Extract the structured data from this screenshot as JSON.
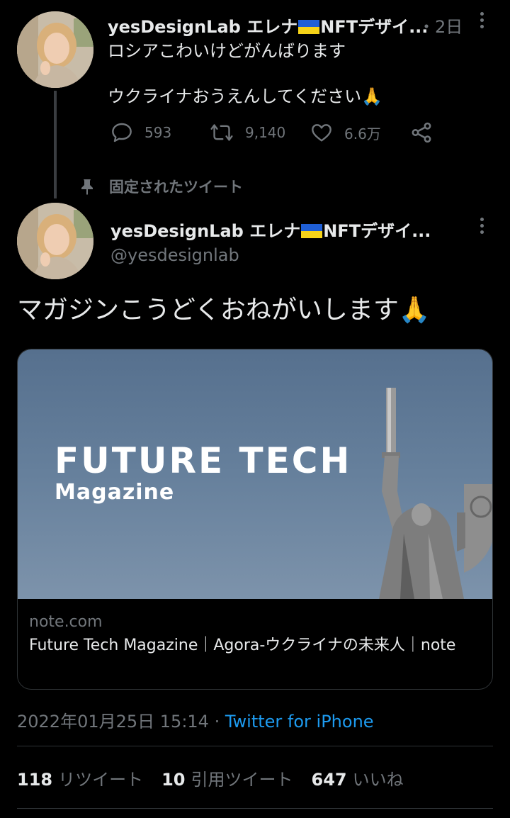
{
  "first_tweet": {
    "name": "yesDesignLab エレナ",
    "name_suffix": "NFTデザイ...",
    "time": "・2日",
    "line1": "ロシアこわいけどがんばります",
    "line2": "ウクライナおうえんしてください🙏",
    "replies": "593",
    "retweets": "9,140",
    "likes": "6.6万"
  },
  "pinned_label": "固定されたツイート",
  "main_tweet": {
    "name": "yesDesignLab エレナ",
    "name_suffix": "NFTデザイ...",
    "handle": "@yesdesignlab",
    "text": "マガジンこうどくおねがいします🙏",
    "card": {
      "image_title": "FUTURE TECH",
      "image_subtitle": "Magazine",
      "domain": "note.com",
      "title": "Future Tech Magazine｜Agora-ウクライナの未来人｜note"
    },
    "timestamp": "2022年01月25日 15:14 · ",
    "source": "Twitter for iPhone",
    "stats": {
      "retweets_count": "118",
      "retweets_label": "リツイート",
      "quotes_count": "10",
      "quotes_label": "引用ツイート",
      "likes_count": "647",
      "likes_label": "いいね"
    }
  },
  "colors": {
    "background": "#000000",
    "text": "#e7e9ea",
    "secondary": "#71767b",
    "link": "#1d9bf0",
    "flag_blue": "#1f5fd6",
    "flag_yellow": "#f6d318"
  },
  "icons": [
    "reply-icon",
    "retweet-icon",
    "like-icon",
    "share-icon",
    "pin-icon",
    "more-icon",
    "ukraine-flag-icon"
  ]
}
